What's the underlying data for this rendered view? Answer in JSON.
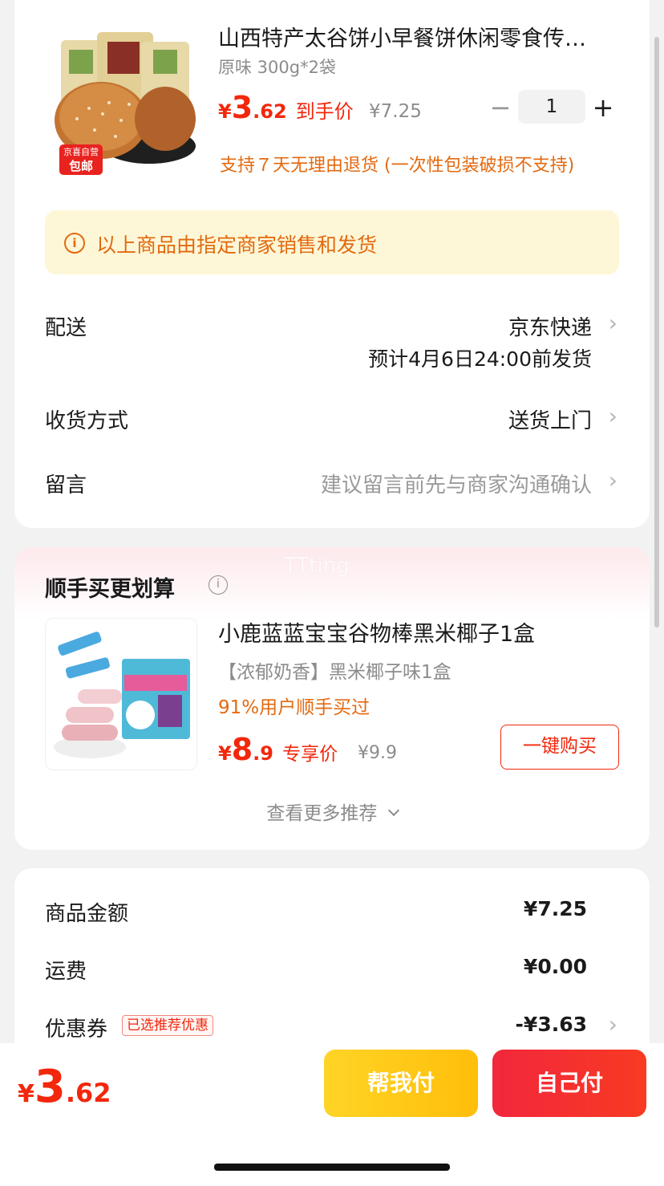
{
  "product": {
    "title": "山西特产太谷饼小早餐饼休闲零食传…",
    "spec": "原味 300g*2袋",
    "price_yen": "¥",
    "price_int": "3",
    "price_dec": ".62",
    "price_tag": "到手价",
    "original_price": "¥7.25",
    "quantity": "1",
    "minus": "−",
    "plus": "+",
    "return_policy": "支持７天无理由退货 (一次性包装破损不支持)",
    "badge_top": "京喜自营",
    "badge_bottom": "包邮"
  },
  "notice": {
    "icon": "info-circle-icon",
    "text": "以上商品由指定商家销售和发货"
  },
  "delivery": {
    "label": "配送",
    "carrier": "京东快递",
    "eta": "预计4月6日24:00前发货"
  },
  "receive": {
    "label": "收货方式",
    "value": "送货上门"
  },
  "message": {
    "label": "留言",
    "placeholder": "建议留言前先与商家沟通确认"
  },
  "recommend": {
    "section_title": "顺手买更划算",
    "watermark": "TTting",
    "title": "小鹿蓝蓝宝宝谷物棒黑米椰子1盒",
    "subtitle": "【浓郁奶香】黑米椰子味1盒",
    "social_proof": "91%用户顺手买过",
    "price_yen": "¥",
    "price_int": "8",
    "price_dec": ".9",
    "price_tag": "专享价",
    "original_price": "¥9.9",
    "buy_button": "一键购买",
    "more_link": "查看更多推荐"
  },
  "summary": {
    "goods_label": "商品金额",
    "goods_value": "¥7.25",
    "shipping_label": "运费",
    "shipping_value": "¥0.00",
    "coupon_label": "优惠券",
    "coupon_badge": "已选推荐优惠",
    "coupon_value": "-¥3.63"
  },
  "footer": {
    "total_yen": "¥",
    "total_int": "3",
    "total_dec": ".62",
    "help_pay": "帮我付",
    "self_pay": "自己付"
  },
  "colors": {
    "accent_red": "#f2270c",
    "orange": "#e36a10",
    "notice_bg": "#fdf7d8",
    "yellow_button": "#ffc414"
  }
}
